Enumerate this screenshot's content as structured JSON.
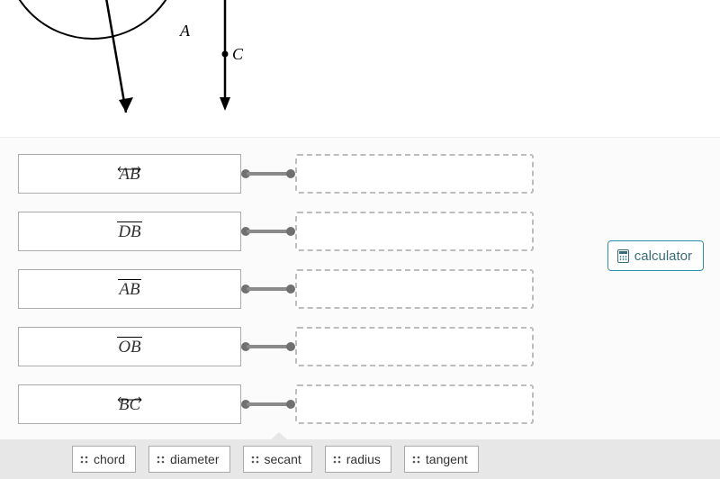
{
  "diagram": {
    "labels": {
      "A": "A",
      "C": "C"
    }
  },
  "matches": [
    {
      "id": "ab-line",
      "text": "AB",
      "overlay": "lr"
    },
    {
      "id": "db-segment",
      "text": "DB",
      "overlay": "bar"
    },
    {
      "id": "ab-segment",
      "text": "AB",
      "overlay": "bar"
    },
    {
      "id": "ob-segment",
      "text": "OB",
      "overlay": "bar"
    },
    {
      "id": "bc-line",
      "text": "BC",
      "overlay": "lr"
    }
  ],
  "options": [
    {
      "id": "chord",
      "label": "chord"
    },
    {
      "id": "diameter",
      "label": "diameter"
    },
    {
      "id": "secant",
      "label": "secant"
    },
    {
      "id": "radius",
      "label": "radius"
    },
    {
      "id": "tangent",
      "label": "tangent"
    }
  ],
  "buttons": {
    "calculator": "calculator"
  }
}
